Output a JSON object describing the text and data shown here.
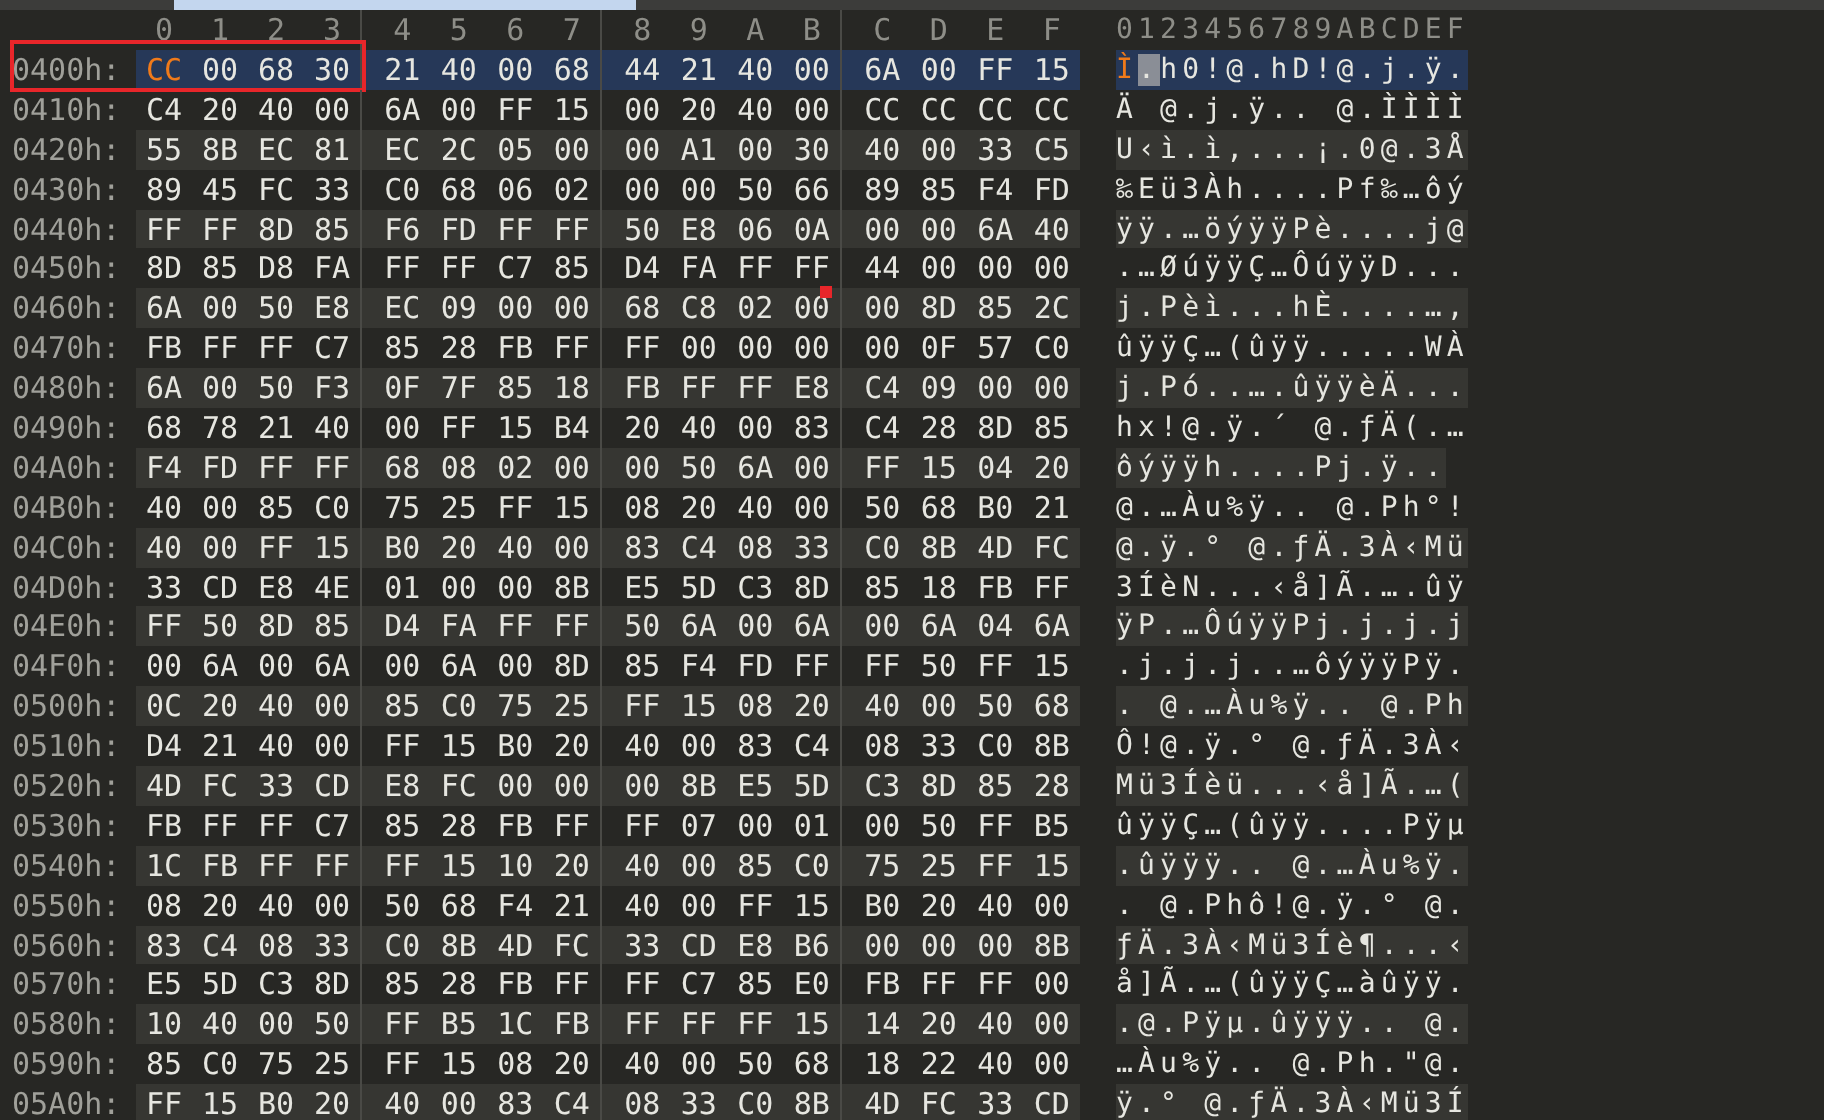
{
  "columns": [
    "0",
    "1",
    "2",
    "3",
    "4",
    "5",
    "6",
    "7",
    "8",
    "9",
    "A",
    "B",
    "C",
    "D",
    "E",
    "F"
  ],
  "ascii_header": "0123456789ABCDEF",
  "rows": [
    {
      "offset": "0400h:",
      "bytes": "CC 00 68 30 21 40 00 68 44 21 40 00 6A 00 FF 15",
      "text": "Ì.h0!@.hD!@.j.ÿ.",
      "selected": true,
      "cursor": true,
      "outlined": true,
      "red_mark": false
    },
    {
      "offset": "0410h:",
      "bytes": "C4 20 40 00 6A 00 FF 15 00 20 40 00 CC CC CC CC",
      "text": "Ä @.j.ÿ.. @.ÌÌÌÌ",
      "selected": false,
      "cursor": false,
      "outlined": false,
      "red_mark": false
    },
    {
      "offset": "0420h:",
      "bytes": "55 8B EC 81 EC 2C 05 00 00 A1 00 30 40 00 33 C5",
      "text": "U‹ì.ì,...¡.0@.3Å",
      "selected": false,
      "cursor": false,
      "outlined": false,
      "red_mark": false
    },
    {
      "offset": "0430h:",
      "bytes": "89 45 FC 33 C0 68 06 02 00 00 50 66 89 85 F4 FD",
      "text": "‰Eü3Àh....Pf‰…ôý",
      "selected": false,
      "cursor": false,
      "outlined": false,
      "red_mark": false
    },
    {
      "offset": "0440h:",
      "bytes": "FF FF 8D 85 F6 FD FF FF 50 E8 06 0A 00 00 6A 40",
      "text": "ÿÿ.…öýÿÿPè....j@",
      "selected": false,
      "cursor": false,
      "outlined": false,
      "red_mark": false
    },
    {
      "offset": "0450h:",
      "bytes": "8D 85 D8 FA FF FF C7 85 D4 FA FF FF 44 00 00 00",
      "text": ".…ØúÿÿÇ…ÔúÿÿD...",
      "selected": false,
      "cursor": false,
      "outlined": false,
      "red_mark": false
    },
    {
      "offset": "0460h:",
      "bytes": "6A 00 50 E8 EC 09 00 00 68 C8 02 00 00 8D 85 2C",
      "text": "j.Pèì...hÈ....…,",
      "selected": false,
      "cursor": false,
      "outlined": false,
      "red_mark": true
    },
    {
      "offset": "0470h:",
      "bytes": "FB FF FF C7 85 28 FB FF FF 00 00 00 00 0F 57 C0",
      "text": "ûÿÿÇ…(ûÿÿ.....WÀ",
      "selected": false,
      "cursor": false,
      "outlined": false,
      "red_mark": false
    },
    {
      "offset": "0480h:",
      "bytes": "6A 00 50 F3 0F 7F 85 18 FB FF FF E8 C4 09 00 00",
      "text": "j.Pó..….ûÿÿèÄ...",
      "selected": false,
      "cursor": false,
      "outlined": false,
      "red_mark": false
    },
    {
      "offset": "0490h:",
      "bytes": "68 78 21 40 00 FF 15 B4 20 40 00 83 C4 28 8D 85",
      "text": "hx!@.ÿ.´ @.ƒÄ(.…",
      "selected": false,
      "cursor": false,
      "outlined": false,
      "red_mark": false
    },
    {
      "offset": "04A0h:",
      "bytes": "F4 FD FF FF 68 08 02 00 00 50 6A 00 FF 15 04 20",
      "text": "ôýÿÿh....Pj.ÿ..",
      "selected": false,
      "cursor": false,
      "outlined": false,
      "red_mark": false
    },
    {
      "offset": "04B0h:",
      "bytes": "40 00 85 C0 75 25 FF 15 08 20 40 00 50 68 B0 21",
      "text": "@.…Àu%ÿ.. @.Ph°!",
      "selected": false,
      "cursor": false,
      "outlined": false,
      "red_mark": false
    },
    {
      "offset": "04C0h:",
      "bytes": "40 00 FF 15 B0 20 40 00 83 C4 08 33 C0 8B 4D FC",
      "text": "@.ÿ.° @.ƒÄ.3À‹Mü",
      "selected": false,
      "cursor": false,
      "outlined": false,
      "red_mark": false
    },
    {
      "offset": "04D0h:",
      "bytes": "33 CD E8 4E 01 00 00 8B E5 5D C3 8D 85 18 FB FF",
      "text": "3ÍèN...‹å]Ã.….ûÿ",
      "selected": false,
      "cursor": false,
      "outlined": false,
      "red_mark": false
    },
    {
      "offset": "04E0h:",
      "bytes": "FF 50 8D 85 D4 FA FF FF 50 6A 00 6A 00 6A 04 6A",
      "text": "ÿP.…ÔúÿÿPj.j.j.j",
      "selected": false,
      "cursor": false,
      "outlined": false,
      "red_mark": false
    },
    {
      "offset": "04F0h:",
      "bytes": "00 6A 00 6A 00 6A 00 8D 85 F4 FD FF FF 50 FF 15",
      "text": ".j.j.j..…ôýÿÿPÿ.",
      "selected": false,
      "cursor": false,
      "outlined": false,
      "red_mark": false
    },
    {
      "offset": "0500h:",
      "bytes": "0C 20 40 00 85 C0 75 25 FF 15 08 20 40 00 50 68",
      "text": ". @.…Àu%ÿ.. @.Ph",
      "selected": false,
      "cursor": false,
      "outlined": false,
      "red_mark": false
    },
    {
      "offset": "0510h:",
      "bytes": "D4 21 40 00 FF 15 B0 20 40 00 83 C4 08 33 C0 8B",
      "text": "Ô!@.ÿ.° @.ƒÄ.3À‹",
      "selected": false,
      "cursor": false,
      "outlined": false,
      "red_mark": false
    },
    {
      "offset": "0520h:",
      "bytes": "4D FC 33 CD E8 FC 00 00 00 8B E5 5D C3 8D 85 28",
      "text": "Mü3Íèü...‹å]Ã.…(",
      "selected": false,
      "cursor": false,
      "outlined": false,
      "red_mark": false
    },
    {
      "offset": "0530h:",
      "bytes": "FB FF FF C7 85 28 FB FF FF 07 00 01 00 50 FF B5",
      "text": "ûÿÿÇ…(ûÿÿ....Pÿµ",
      "selected": false,
      "cursor": false,
      "outlined": false,
      "red_mark": false
    },
    {
      "offset": "0540h:",
      "bytes": "1C FB FF FF FF 15 10 20 40 00 85 C0 75 25 FF 15",
      "text": ".ûÿÿÿ.. @.…Àu%ÿ.",
      "selected": false,
      "cursor": false,
      "outlined": false,
      "red_mark": false
    },
    {
      "offset": "0550h:",
      "bytes": "08 20 40 00 50 68 F4 21 40 00 FF 15 B0 20 40 00",
      "text": ". @.Phô!@.ÿ.° @.",
      "selected": false,
      "cursor": false,
      "outlined": false,
      "red_mark": false
    },
    {
      "offset": "0560h:",
      "bytes": "83 C4 08 33 C0 8B 4D FC 33 CD E8 B6 00 00 00 8B",
      "text": "ƒÄ.3À‹Mü3Íè¶...‹",
      "selected": false,
      "cursor": false,
      "outlined": false,
      "red_mark": false
    },
    {
      "offset": "0570h:",
      "bytes": "E5 5D C3 8D 85 28 FB FF FF C7 85 E0 FB FF FF 00",
      "text": "å]Ã.…(ûÿÿÇ…àûÿÿ.",
      "selected": false,
      "cursor": false,
      "outlined": false,
      "red_mark": false
    },
    {
      "offset": "0580h:",
      "bytes": "10 40 00 50 FF B5 1C FB FF FF FF 15 14 20 40 00",
      "text": ".@.Pÿµ.ûÿÿÿ.. @.",
      "selected": false,
      "cursor": false,
      "outlined": false,
      "red_mark": false
    },
    {
      "offset": "0590h:",
      "bytes": "85 C0 75 25 FF 15 08 20 40 00 50 68 18 22 40 00",
      "text": "…Àu%ÿ.. @.Ph.\"@.",
      "selected": false,
      "cursor": false,
      "outlined": false,
      "red_mark": false
    },
    {
      "offset": "05A0h:",
      "bytes": "FF 15 B0 20 40 00 83 C4 08 33 C0 8B 4D FC 33 CD",
      "text": "ÿ.° @.ƒÄ.3À‹Mü3Í",
      "selected": false,
      "cursor": false,
      "outlined": false,
      "red_mark": false
    }
  ]
}
